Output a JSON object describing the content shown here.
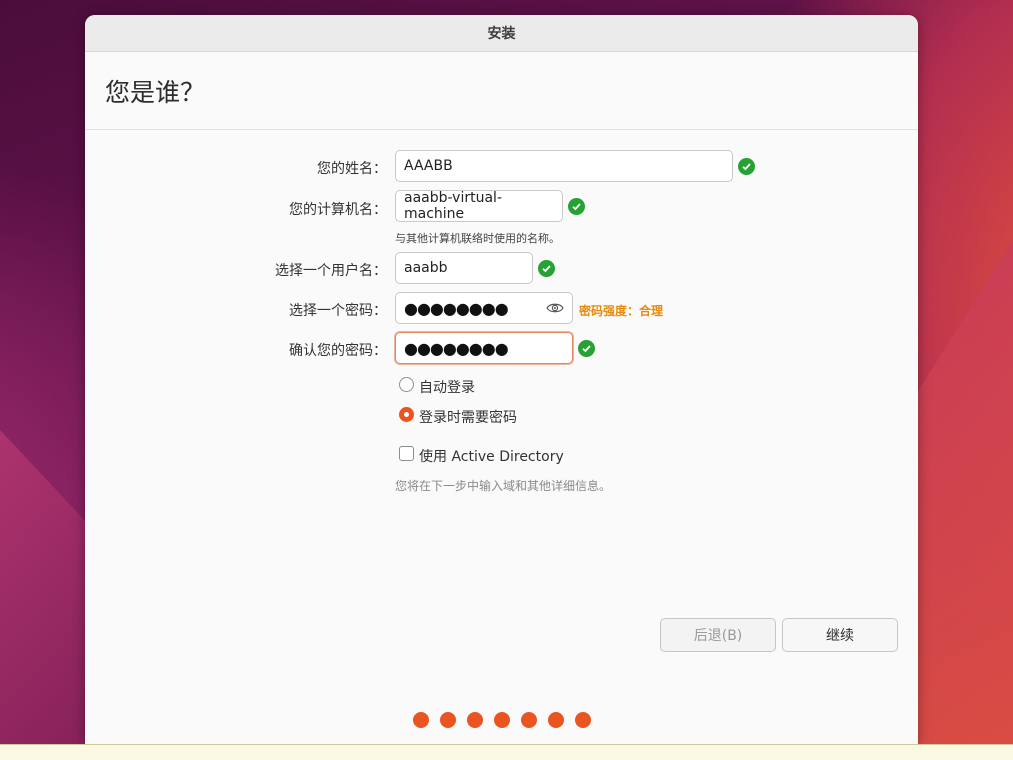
{
  "window": {
    "title": "安装"
  },
  "page": {
    "heading": "您是谁？"
  },
  "form": {
    "name_label": "您的姓名：",
    "name_value": "AAABB",
    "computer_label": "您的计算机名：",
    "computer_value": "aaabb-virtual-machine",
    "computer_hint": "与其他计算机联络时使用的名称。",
    "username_label": "选择一个用户名：",
    "username_value": "aaabb",
    "password_label": "选择一个密码：",
    "password_value": "●●●●●●●●",
    "password_strength": "密码强度：合理",
    "confirm_label": "确认您的密码：",
    "confirm_value": "●●●●●●●●"
  },
  "login_options": {
    "auto_login": "自动登录",
    "require_password": "登录时需要密码",
    "selected": "require_password"
  },
  "active_directory": {
    "label": "使用 Active Directory",
    "checked": false,
    "hint": "您将在下一步中输入域和其他详细信息。"
  },
  "buttons": {
    "back": "后退(B)",
    "continue": "继续"
  },
  "progress": {
    "total_steps": 7
  },
  "colors": {
    "accent": "#e95420",
    "valid": "#26a233",
    "strength": "#e88a0c"
  }
}
